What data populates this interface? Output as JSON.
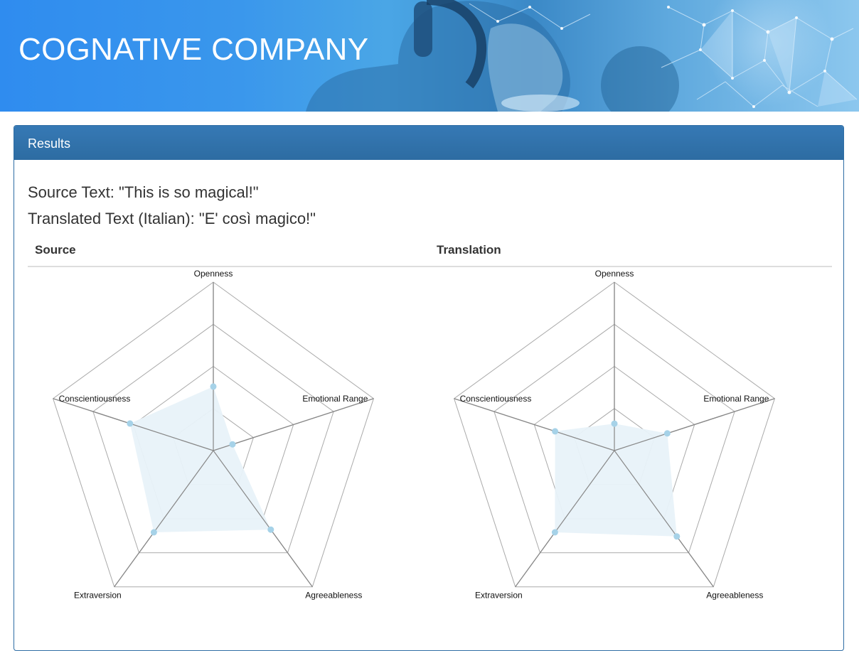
{
  "header": {
    "brand": "COGNATIVE COMPANY"
  },
  "results": {
    "title": "Results",
    "source_text_line": "Source Text: \"This is so magical!\"",
    "translated_text_line": "Translated Text (Italian): \"E' così magico!\"",
    "columns": [
      "Source",
      "Translation"
    ]
  },
  "colors": {
    "header_blue": "#2f8cef",
    "panel_heading": "#337ab7",
    "data_point": "#a6d2e8",
    "data_fill": "#e8f2f9",
    "grid": "#999999"
  },
  "chart_data": [
    {
      "type": "radar",
      "title": "Source",
      "axes": [
        "Openness",
        "Emotional Range",
        "Agreeableness",
        "Extraversion",
        "Conscientiousness"
      ],
      "values": [
        0.38,
        0.12,
        0.58,
        0.6,
        0.52
      ],
      "range": [
        0,
        1
      ],
      "grid_levels": 4
    },
    {
      "type": "radar",
      "title": "Translation",
      "axes": [
        "Openness",
        "Emotional Range",
        "Agreeableness",
        "Extraversion",
        "Conscientiousness"
      ],
      "values": [
        0.16,
        0.33,
        0.63,
        0.6,
        0.37
      ],
      "range": [
        0,
        1
      ],
      "grid_levels": 4
    }
  ]
}
